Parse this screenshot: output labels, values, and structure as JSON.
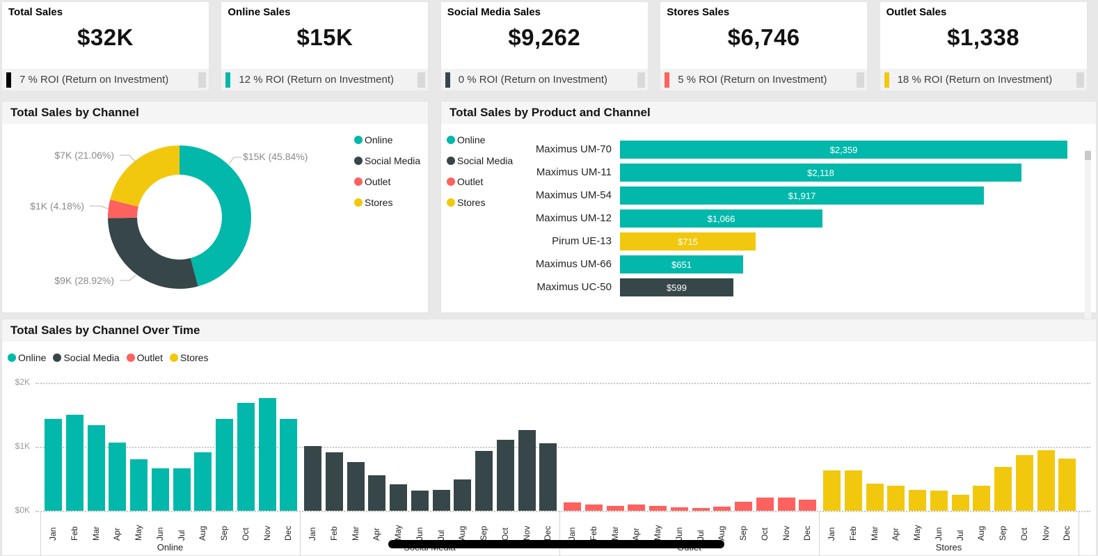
{
  "cards": [
    {
      "title": "Total Sales",
      "value": "$32K",
      "roi": "7 % ROI (Return on Investment)",
      "marker_color": "#000000"
    },
    {
      "title": "Online Sales",
      "value": "$15K",
      "roi": "12 % ROI (Return on Investment)",
      "marker_color": "#01B8AA"
    },
    {
      "title": "Social Media Sales",
      "value": "$9,262",
      "roi": "0 % ROI (Return on Investment)",
      "marker_color": "#374649"
    },
    {
      "title": "Stores Sales",
      "value": "$6,746",
      "roi": "5 % ROI (Return on Investment)",
      "marker_color": "#FD625E"
    },
    {
      "title": "Outlet Sales",
      "value": "$1,338",
      "roi": "18 % ROI (Return on Investment)",
      "marker_color": "#F2C80F"
    }
  ],
  "channel_colors": {
    "Online": "#01B8AA",
    "Social Media": "#374649",
    "Outlet": "#FD625E",
    "Stores": "#F2C80F"
  },
  "legend_order": [
    "Online",
    "Social Media",
    "Outlet",
    "Stores"
  ],
  "chart_data": [
    {
      "type": "pie",
      "title": "Total Sales by Channel",
      "slices": [
        {
          "name": "Online",
          "value": 15000,
          "pct": 45.84,
          "callout": "$15K (45.84%)"
        },
        {
          "name": "Social Media",
          "value": 9262,
          "pct": 28.92,
          "callout": "$9K (28.92%)"
        },
        {
          "name": "Outlet",
          "value": 1338,
          "pct": 4.18,
          "callout": "$1K (4.18%)"
        },
        {
          "name": "Stores",
          "value": 6746,
          "pct": 21.06,
          "callout": "$7K (21.06%)"
        }
      ],
      "legend_position": "right"
    },
    {
      "type": "bar",
      "title": "Total Sales by Product and Channel",
      "categories": [
        "Maximus UM-70",
        "Maximus UM-11",
        "Maximus UM-54",
        "Maximus UM-12",
        "Pirum UE-13",
        "Maximus UM-66",
        "Maximus UC-50"
      ],
      "values": [
        2359,
        2118,
        1917,
        1066,
        715,
        651,
        599
      ],
      "value_labels": [
        "$2,359",
        "$2,118",
        "$1,917",
        "$1,066",
        "$715",
        "$651",
        "$599"
      ],
      "channels": [
        "Online",
        "Online",
        "Online",
        "Online",
        "Stores",
        "Online",
        "Social Media"
      ],
      "xmax": 2359,
      "legend_position": "left"
    },
    {
      "type": "bar",
      "title": "Total Sales by Channel Over Time",
      "categories": [
        "Jan",
        "Feb",
        "Mar",
        "Apr",
        "May",
        "Jun",
        "Jul",
        "Aug",
        "Sep",
        "Oct",
        "Nov",
        "Dec"
      ],
      "series": [
        {
          "name": "Online",
          "values": [
            1430,
            1500,
            1340,
            1060,
            800,
            660,
            660,
            910,
            1440,
            1690,
            1760,
            1440
          ]
        },
        {
          "name": "Social Media",
          "values": [
            1010,
            910,
            760,
            550,
            410,
            320,
            330,
            490,
            940,
            1110,
            1260,
            1050
          ]
        },
        {
          "name": "Outlet",
          "values": [
            130,
            100,
            75,
            100,
            75,
            50,
            45,
            70,
            140,
            210,
            210,
            170
          ]
        },
        {
          "name": "Stores",
          "values": [
            630,
            630,
            420,
            390,
            330,
            310,
            250,
            390,
            690,
            870,
            950,
            810
          ]
        }
      ],
      "ylim": [
        0,
        2000
      ],
      "ytick_labels": [
        "$0K",
        "$1K",
        "$2K"
      ],
      "grid": "dotted",
      "legend_position": "top"
    }
  ]
}
